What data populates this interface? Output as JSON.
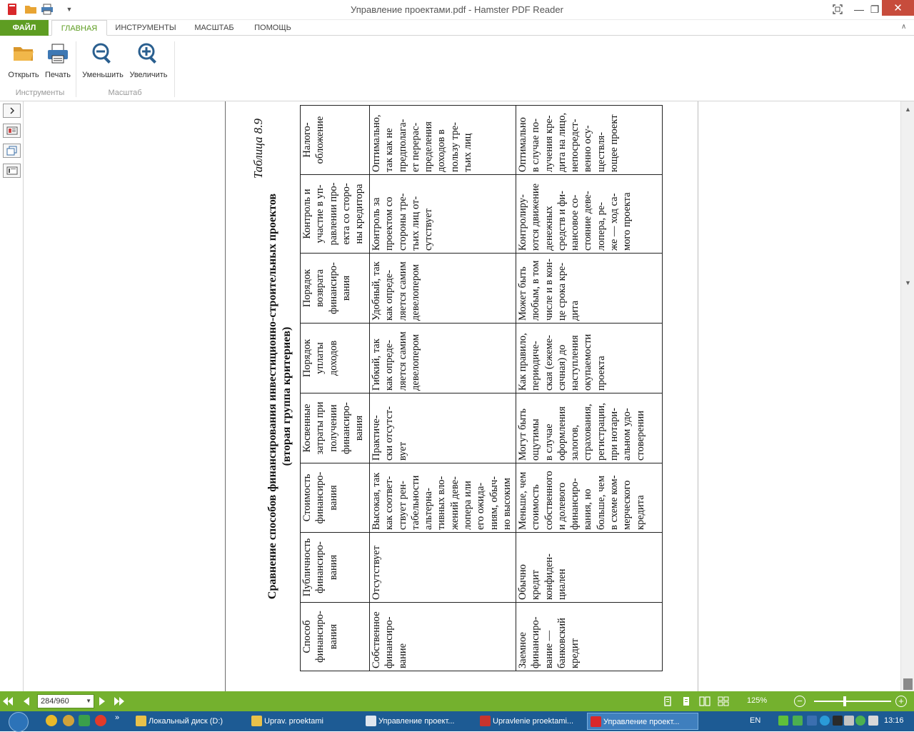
{
  "window": {
    "title": "Управление проектами.pdf - Hamster PDF Reader",
    "controls": {
      "minimize": "—",
      "maximize": "❐",
      "close": "✕",
      "fullscreen": "⛶"
    }
  },
  "quick_access": [
    "app-icon",
    "open-icon",
    "print-icon",
    "customize-icon"
  ],
  "ribbon": {
    "tabs": [
      "ФАЙЛ",
      "ГЛАВНАЯ",
      "ИНСТРУМЕНТЫ",
      "МАСШТАБ",
      "ПОМОЩЬ"
    ],
    "active_tab": "ГЛАВНАЯ",
    "groups": [
      {
        "label": "Инструменты",
        "buttons": [
          "Открыть",
          "Печать"
        ]
      },
      {
        "label": "Масштаб",
        "buttons": [
          "Уменьшить",
          "Увеличить"
        ]
      }
    ]
  },
  "document": {
    "caption": "Таблица 8.9",
    "heading_line1": "Сравнение способов финансирования инвестиционно-строительных проектов",
    "heading_line2": "(вторая группа критериев)",
    "headers": [
      [
        "Способ",
        "финансиро-",
        "вания"
      ],
      [
        "Публичность",
        "финансиро-",
        "вания"
      ],
      [
        "Стоимость",
        "финансиро-",
        "вания"
      ],
      [
        "Косвенные",
        "затраты при",
        "получении",
        "финансиро-",
        "вания"
      ],
      [
        "Порядок",
        "уплаты",
        "доходов"
      ],
      [
        "Порядок",
        "возврата",
        "финансиро-",
        "вания"
      ],
      [
        "Контроль и",
        "участие в уп-",
        "равлении про-",
        "екта со сторо-",
        "ны кредитора"
      ],
      [
        "Налого-",
        "обложение"
      ]
    ],
    "rows": [
      [
        [
          "Собственное",
          "финансиро-",
          "вание"
        ],
        [
          "Отсутствует"
        ],
        [
          "Высокая, так",
          "как соответ-",
          "ствует рен-",
          "табельности",
          "альтерна-",
          "тивных вло-",
          "жений деве-",
          "лопера или",
          "его ожида-",
          "ниям, обыч-",
          "но высоким"
        ],
        [
          "Практиче-",
          "ски отсутст-",
          "вует"
        ],
        [
          "Гибкий, так",
          "как опреде-",
          "ляется самим",
          "девелопером"
        ],
        [
          "Удобный, так",
          "как опреде-",
          "ляется самим",
          "девелопером"
        ],
        [
          "Контроль за",
          "проектом со",
          "стороны тре-",
          "тьих лиц от-",
          "сутствует"
        ],
        [
          "Оптимально,",
          "так как не",
          "предполага-",
          "ет перерас-",
          "пределения",
          "доходов в",
          "пользу тре-",
          "тьих лиц"
        ]
      ],
      [
        [
          "Заемное",
          "финансиро-",
          "вание —",
          "банковский",
          "кредит"
        ],
        [
          "Обычно",
          "кредит",
          "конфиден-",
          "циален"
        ],
        [
          "Меньше, чем",
          "стоимость",
          "собственного",
          "и долевого",
          "финансиро-",
          "вания, но",
          "больше, чем",
          "в схеме ком-",
          "мерческого",
          "кредита"
        ],
        [
          "Могут быть",
          "ощутимы",
          "в случае",
          "оформления",
          "залогов,",
          "страхования,",
          "регистрации,",
          "при нотари-",
          "альном удо-",
          "стоверении"
        ],
        [
          "Как правило,",
          "периодиче-",
          "ская (ежеме-",
          "сячная) до",
          "наступления",
          "окупаемости",
          "проекта"
        ],
        [
          "Может быть",
          "любым, в том",
          "числе и в кон-",
          "це срока кре-",
          "дита"
        ],
        [
          "Контролиру-",
          "ются движение",
          "денежных",
          "средств и фи-",
          "нансовое со-",
          "стояние деве-",
          "лопера, ре-",
          "же — ход са-",
          "мого проекта"
        ],
        [
          "Оптимально",
          "в случае по-",
          "лучения кре-",
          "дита на лицо,",
          "непосредст-",
          "венно осу-",
          "ществля-",
          "ющее проект"
        ]
      ]
    ]
  },
  "statusbar": {
    "page_field": "284/960",
    "zoom": "125%",
    "zoom_level": 0.4
  },
  "taskbar": {
    "items": [
      "Локальный диск (D:)",
      "Uprav. proektami",
      "Управление проект...",
      "Upravlenie proektami...",
      "Управление проект..."
    ],
    "active_index": 4,
    "lang": "EN",
    "time": "13:16"
  }
}
